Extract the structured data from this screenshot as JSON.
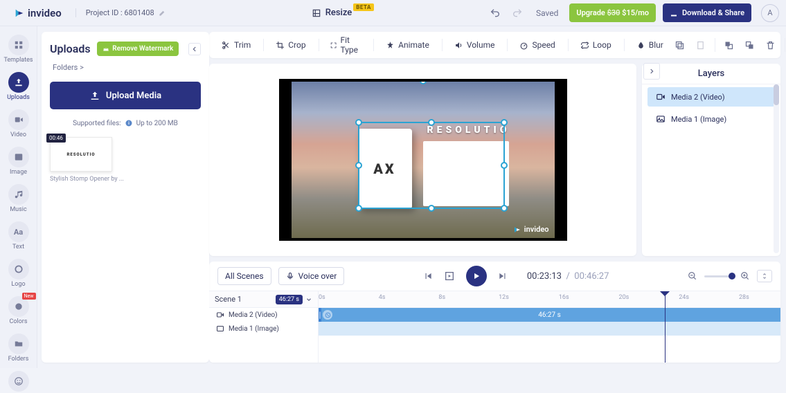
{
  "brand": "invideo",
  "project": {
    "label": "Project ID : 6801408"
  },
  "resize": {
    "label": "Resize",
    "badge": "BETA"
  },
  "topbar": {
    "saved": "Saved",
    "upgrade_prefix": "Upgrade",
    "upgrade_strike": "$30",
    "upgrade_price": "$15/mo",
    "download": "Download & Share",
    "avatar": "A"
  },
  "sidebar": [
    {
      "key": "templates",
      "label": "Templates"
    },
    {
      "key": "uploads",
      "label": "Uploads"
    },
    {
      "key": "video",
      "label": "Video"
    },
    {
      "key": "image",
      "label": "Image"
    },
    {
      "key": "music",
      "label": "Music"
    },
    {
      "key": "text",
      "label": "Text"
    },
    {
      "key": "logo",
      "label": "Logo"
    },
    {
      "key": "colors",
      "label": "Colors",
      "badge": "New"
    },
    {
      "key": "folders",
      "label": "Folders"
    }
  ],
  "panel": {
    "title": "Uploads",
    "remove_watermark": "Remove Watermark",
    "breadcrumb": "Folders >",
    "upload_button": "Upload Media",
    "supported": "Supported files:",
    "supported_limit": "Up to 200 MB",
    "thumb": {
      "duration": "00:46",
      "caption": "Stylish Stomp Opener by ...",
      "text": ""
    }
  },
  "tools": {
    "trim": "Trim",
    "crop": "Crop",
    "fit": "Fit Type",
    "animate": "Animate",
    "volume": "Volume",
    "speed": "Speed",
    "loop": "Loop",
    "blur": "Blur"
  },
  "canvas": {
    "card1_text": "AX",
    "reso_text": "RESOLUTIO",
    "watermark": "invideo"
  },
  "layers": {
    "title": "Layers",
    "items": [
      {
        "name": "Media 2 (Video)"
      },
      {
        "name": "Media 1 (Image)"
      }
    ]
  },
  "timeline": {
    "all_scenes": "All Scenes",
    "voice_over": "Voice over",
    "time_current": "00:23:13",
    "time_total": "00:46:27",
    "scene": {
      "label": "Scene 1",
      "duration": "46:27 s"
    },
    "tracks": [
      {
        "name": "Media 2 (Video)",
        "clip_label": "46:27 s"
      },
      {
        "name": "Media 1 (Image)"
      }
    ],
    "ticks": [
      "0s",
      "4s",
      "8s",
      "12s",
      "16s",
      "20s",
      "24s",
      "28s"
    ],
    "playhead_pct": 75
  }
}
